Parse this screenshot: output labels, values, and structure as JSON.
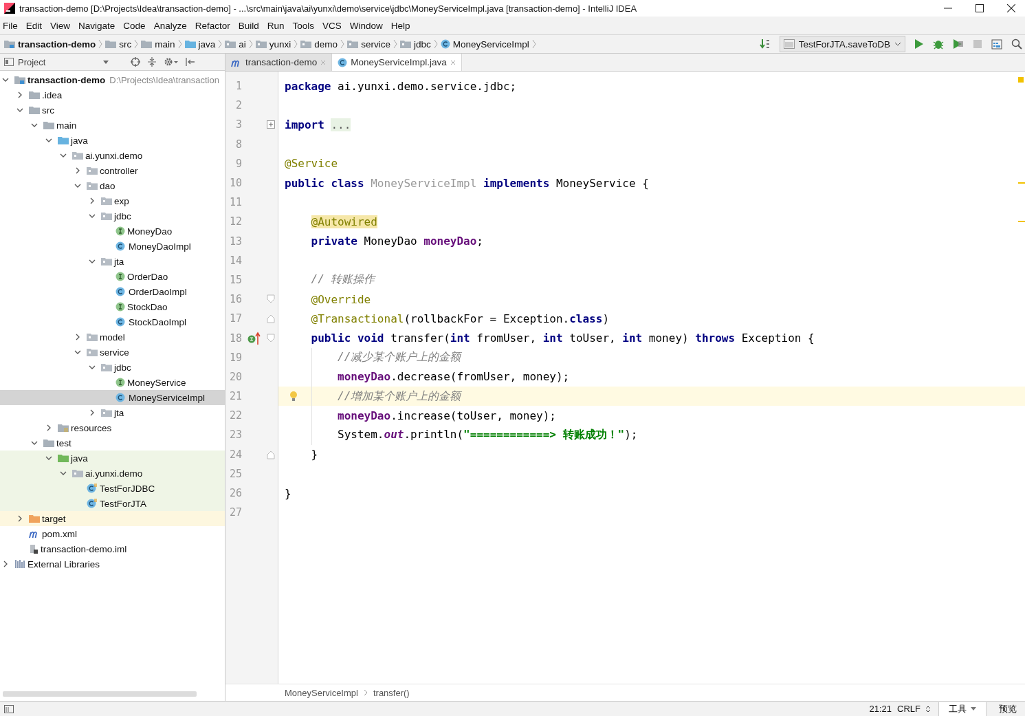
{
  "window": {
    "title": "transaction-demo [D:\\Projects\\Idea\\transaction-demo] - ...\\src\\main\\java\\ai\\yunxi\\demo\\service\\jdbc\\MoneyServiceImpl.java [transaction-demo] - IntelliJ IDEA"
  },
  "menu": [
    "File",
    "Edit",
    "View",
    "Navigate",
    "Code",
    "Analyze",
    "Refactor",
    "Build",
    "Run",
    "Tools",
    "VCS",
    "Window",
    "Help"
  ],
  "navbar": {
    "crumbs": [
      {
        "label": "transaction-demo",
        "kind": "project"
      },
      {
        "label": "src",
        "kind": "folder"
      },
      {
        "label": "main",
        "kind": "folder"
      },
      {
        "label": "java",
        "kind": "source"
      },
      {
        "label": "ai",
        "kind": "package"
      },
      {
        "label": "yunxi",
        "kind": "package"
      },
      {
        "label": "demo",
        "kind": "package"
      },
      {
        "label": "service",
        "kind": "package"
      },
      {
        "label": "jdbc",
        "kind": "package"
      },
      {
        "label": "MoneyServiceImpl",
        "kind": "class"
      }
    ],
    "run_config": "TestForJTA.saveToDB"
  },
  "project": {
    "title": "Project",
    "tree": [
      {
        "label": "transaction-demo",
        "path": "D:\\Projects\\Idea\\transaction",
        "kind": "project",
        "expanded": true,
        "selected": false,
        "children": [
          {
            "label": ".idea",
            "kind": "folder",
            "expanded": false,
            "selected": false
          },
          {
            "label": "src",
            "kind": "folder",
            "expanded": true,
            "selected": false,
            "children": [
              {
                "label": "main",
                "kind": "folder",
                "expanded": true,
                "selected": false,
                "children": [
                  {
                    "label": "java",
                    "kind": "source",
                    "expanded": true,
                    "selected": false,
                    "children": [
                      {
                        "label": "ai.yunxi.demo",
                        "kind": "package",
                        "expanded": true,
                        "selected": false,
                        "children": [
                          {
                            "label": "controller",
                            "kind": "package",
                            "expanded": false,
                            "selected": false
                          },
                          {
                            "label": "dao",
                            "kind": "package",
                            "expanded": true,
                            "selected": false,
                            "children": [
                              {
                                "label": "exp",
                                "kind": "package",
                                "expanded": false,
                                "selected": false
                              },
                              {
                                "label": "jdbc",
                                "kind": "package",
                                "expanded": true,
                                "selected": false,
                                "children": [
                                  {
                                    "label": "MoneyDao",
                                    "kind": "interface",
                                    "selected": false
                                  },
                                  {
                                    "label": "MoneyDaoImpl",
                                    "kind": "class",
                                    "selected": false
                                  }
                                ]
                              },
                              {
                                "label": "jta",
                                "kind": "package",
                                "expanded": true,
                                "selected": false,
                                "children": [
                                  {
                                    "label": "OrderDao",
                                    "kind": "interface",
                                    "selected": false
                                  },
                                  {
                                    "label": "OrderDaoImpl",
                                    "kind": "class",
                                    "selected": false
                                  },
                                  {
                                    "label": "StockDao",
                                    "kind": "interface",
                                    "selected": false
                                  },
                                  {
                                    "label": "StockDaoImpl",
                                    "kind": "class",
                                    "selected": false
                                  }
                                ]
                              }
                            ]
                          },
                          {
                            "label": "model",
                            "kind": "package",
                            "expanded": false,
                            "selected": false
                          },
                          {
                            "label": "service",
                            "kind": "package",
                            "expanded": true,
                            "selected": false,
                            "children": [
                              {
                                "label": "jdbc",
                                "kind": "package",
                                "expanded": true,
                                "selected": false,
                                "children": [
                                  {
                                    "label": "MoneyService",
                                    "kind": "interface",
                                    "selected": false
                                  },
                                  {
                                    "label": "MoneyServiceImpl",
                                    "kind": "class",
                                    "selected": true
                                  }
                                ]
                              },
                              {
                                "label": "jta",
                                "kind": "package",
                                "expanded": false,
                                "selected": false
                              }
                            ]
                          }
                        ]
                      }
                    ]
                  },
                  {
                    "label": "resources",
                    "kind": "resources",
                    "expanded": false,
                    "selected": false
                  }
                ]
              },
              {
                "label": "test",
                "kind": "folder",
                "expanded": true,
                "selected": false,
                "children": [
                  {
                    "label": "java",
                    "kind": "test-source",
                    "in_test": true,
                    "expanded": true,
                    "selected": false,
                    "children": [
                      {
                        "label": "ai.yunxi.demo",
                        "kind": "package",
                        "in_test": true,
                        "expanded": true,
                        "selected": false,
                        "children": [
                          {
                            "label": "TestForJDBC",
                            "kind": "test-class",
                            "in_test": true,
                            "selected": false
                          },
                          {
                            "label": "TestForJTA",
                            "kind": "test-class",
                            "in_test": true,
                            "selected": false
                          }
                        ]
                      }
                    ]
                  }
                ]
              }
            ]
          },
          {
            "label": "target",
            "kind": "excluded",
            "excluded": true,
            "expanded": false,
            "selected": false
          },
          {
            "label": "pom.xml",
            "kind": "maven",
            "selected": false
          },
          {
            "label": "transaction-demo.iml",
            "kind": "iml",
            "selected": false
          }
        ]
      },
      {
        "label": "External Libraries",
        "kind": "libraries",
        "expanded": false,
        "selected": false
      }
    ]
  },
  "tabs": [
    {
      "label": "transaction-demo",
      "kind": "maven",
      "selected": false
    },
    {
      "label": "MoneyServiceImpl.java",
      "kind": "class",
      "selected": true
    }
  ],
  "editor": {
    "lines": [
      {
        "no": "1",
        "tokens": [
          {
            "kind": "kw",
            "text": "package"
          },
          {
            "kind": "plain",
            "text": " ai.yunxi.demo.service.jdbc;"
          }
        ]
      },
      {
        "no": "2"
      },
      {
        "no": "3",
        "folded": true,
        "tokens": [
          {
            "kind": "kw",
            "text": "import "
          },
          {
            "kind": "folded",
            "text": "..."
          }
        ]
      },
      {
        "no": "8"
      },
      {
        "no": "9",
        "tokens": [
          {
            "kind": "ann",
            "text": "@Service"
          }
        ]
      },
      {
        "no": "10",
        "stripe": true,
        "tokens": [
          {
            "kind": "kw",
            "text": "public class "
          },
          {
            "kind": "unused",
            "text": "MoneyServiceImpl "
          },
          {
            "kind": "kw",
            "text": "implements"
          },
          {
            "kind": "plain",
            "text": " MoneyService {"
          }
        ]
      },
      {
        "no": "11"
      },
      {
        "no": "12",
        "in_class": true,
        "stripe": true,
        "tokens": [
          {
            "kind": "warn",
            "text": "@Autowired"
          }
        ]
      },
      {
        "no": "13",
        "in_class": true,
        "tokens": [
          {
            "kind": "kw",
            "text": "private"
          },
          {
            "kind": "plain",
            "text": " MoneyDao "
          },
          {
            "kind": "field",
            "text": "moneyDao"
          },
          {
            "kind": "plain",
            "text": ";"
          }
        ]
      },
      {
        "no": "14"
      },
      {
        "no": "15",
        "in_class": true,
        "tokens": [
          {
            "kind": "comment",
            "text": "// 转账操作"
          }
        ]
      },
      {
        "no": "16",
        "in_class": true,
        "fold_start": true,
        "tokens": [
          {
            "kind": "ann",
            "text": "@Override"
          }
        ]
      },
      {
        "no": "17",
        "in_class": true,
        "fold_end": true,
        "tokens": [
          {
            "kind": "ann",
            "text": "@Transactional"
          },
          {
            "kind": "plain",
            "text": "(rollbackFor = Exception."
          },
          {
            "kind": "kw",
            "text": "class"
          },
          {
            "kind": "plain",
            "text": ")"
          }
        ]
      },
      {
        "no": "18",
        "in_class": true,
        "fold_start": true,
        "implements_marker": true,
        "tokens": [
          {
            "kind": "kw",
            "text": "public void"
          },
          {
            "kind": "plain",
            "text": " transfer("
          },
          {
            "kind": "kw",
            "text": "int"
          },
          {
            "kind": "plain",
            "text": " fromUser, "
          },
          {
            "kind": "kw",
            "text": "int"
          },
          {
            "kind": "plain",
            "text": " toUser, "
          },
          {
            "kind": "kw",
            "text": "int"
          },
          {
            "kind": "plain",
            "text": " money) "
          },
          {
            "kind": "kw",
            "text": "throws"
          },
          {
            "kind": "plain",
            "text": " Exception {"
          }
        ]
      },
      {
        "no": "19",
        "in_method": true,
        "tokens": [
          {
            "kind": "comment",
            "text": "//减少某个账户上的金额"
          }
        ]
      },
      {
        "no": "20",
        "in_method": true,
        "tokens": [
          {
            "kind": "field",
            "text": "moneyDao"
          },
          {
            "kind": "plain",
            "text": ".decrease(fromUser, money);"
          }
        ]
      },
      {
        "no": "21",
        "in_method": true,
        "current": true,
        "intention_bulb": true,
        "tokens": [
          {
            "kind": "comment",
            "text": "//增加某个账户上的金额"
          }
        ]
      },
      {
        "no": "22",
        "in_method": true,
        "tokens": [
          {
            "kind": "field",
            "text": "moneyDao"
          },
          {
            "kind": "plain",
            "text": ".increase(toUser, money);"
          }
        ]
      },
      {
        "no": "23",
        "in_method": true,
        "tokens": [
          {
            "kind": "plain",
            "text": "System."
          },
          {
            "kind": "static",
            "text": "out"
          },
          {
            "kind": "plain",
            "text": ".println("
          },
          {
            "kind": "string",
            "text": "\"============> 转账成功！\""
          },
          {
            "kind": "plain",
            "text": ");"
          }
        ]
      },
      {
        "no": "24",
        "in_class": true,
        "fold_end": true,
        "tokens": [
          {
            "kind": "plain",
            "text": "}"
          }
        ]
      },
      {
        "no": "25"
      },
      {
        "no": "26",
        "tokens": [
          {
            "kind": "plain",
            "text": "}"
          }
        ]
      },
      {
        "no": "27"
      }
    ],
    "breadcrumbs": [
      "MoneyServiceImpl",
      "transfer()"
    ]
  },
  "status_bar": {
    "position": "21:21",
    "line_separator": "CRLF",
    "tools": "工具",
    "preview": "预览"
  }
}
